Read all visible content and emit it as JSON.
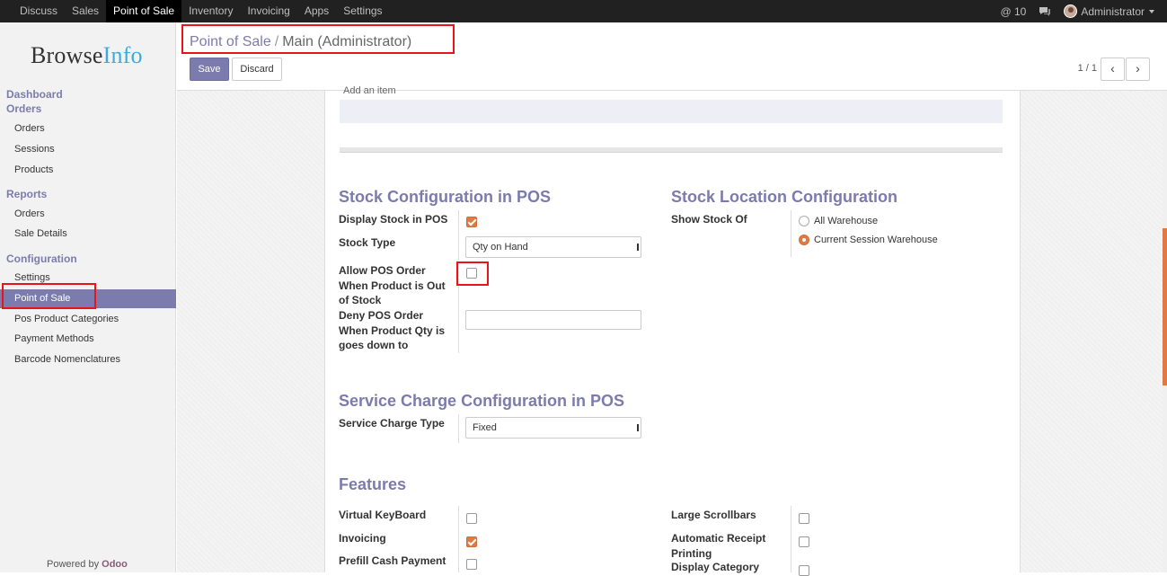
{
  "topnav": {
    "menus": [
      "Discuss",
      "Sales",
      "Point of Sale",
      "Inventory",
      "Invoicing",
      "Apps",
      "Settings"
    ],
    "active": "Point of Sale",
    "notifications": "@ 10",
    "user": "Administrator"
  },
  "sidebar": {
    "logo_a": "Browse",
    "logo_b": "Info",
    "sections": {
      "dashboard": "Dashboard",
      "orders": "Orders",
      "reports": "Reports",
      "configuration": "Configuration"
    },
    "items": {
      "orders": "Orders",
      "sessions": "Sessions",
      "products": "Products",
      "report_orders": "Orders",
      "sale_details": "Sale Details",
      "settings": "Settings",
      "point_of_sale": "Point of Sale",
      "pos_categories": "Pos Product Categories",
      "payment_methods": "Payment Methods",
      "barcode": "Barcode Nomenclatures"
    },
    "powered_by": "Powered by",
    "odoo": "Odoo"
  },
  "control_panel": {
    "breadcrumb_link": "Point of Sale",
    "breadcrumb_sep": "/",
    "breadcrumb_current": "Main (Administrator)",
    "save": "Save",
    "discard": "Discard",
    "pager": "1 / 1"
  },
  "form": {
    "cut_label": "Add an item",
    "stock_config": {
      "title": "Stock Configuration in POS",
      "display_stock_label": "Display Stock in POS",
      "display_stock": true,
      "stock_type_label": "Stock Type",
      "stock_type_value": "Qty on Hand",
      "allow_order_label": "Allow POS Order When Product is Out of Stock",
      "allow_order": false,
      "deny_order_label": "Deny POS Order When Product Qty is goes down to",
      "deny_order_value": ""
    },
    "stock_location": {
      "title": "Stock Location Configuration",
      "show_stock_label": "Show Stock Of",
      "options": [
        "All Warehouse",
        "Current Session Warehouse"
      ],
      "selected": "Current Session Warehouse"
    },
    "service_charge": {
      "title": "Service Charge Configuration in POS",
      "type_label": "Service Charge Type",
      "type_value": "Fixed"
    },
    "features": {
      "title": "Features",
      "virtual_keyboard": "Virtual KeyBoard",
      "invoicing": "Invoicing",
      "prefill_cash": "Prefill Cash Payment",
      "large_scrollbars": "Large Scrollbars",
      "auto_receipt": "Automatic Receipt Printing",
      "display_category": "Display Category"
    }
  },
  "colors": {
    "accent": "#7c7bad",
    "checkbox": "#e07a45",
    "highlight": "#e8141a"
  }
}
